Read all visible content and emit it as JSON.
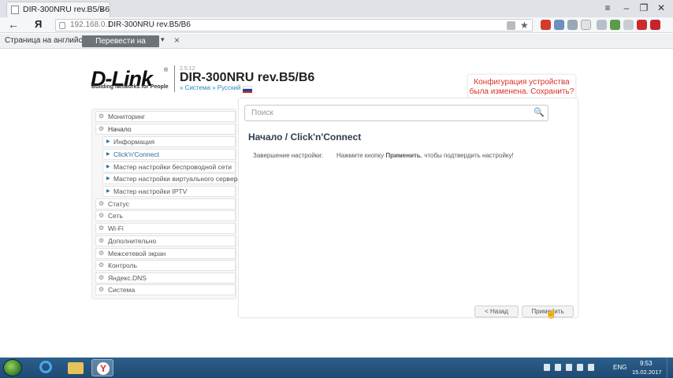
{
  "browser": {
    "tab_title": "DIR-300NRU rev.B5/B6",
    "address_ip": "192.168.0.1",
    "address_title": "DIR-300NRU rev.B5/B6",
    "yandex_logo": "Я",
    "back_icon": "←",
    "tab_close": "×",
    "star_icon": "★",
    "window_buttons": [
      "≡",
      "–",
      "❐",
      "✕"
    ]
  },
  "translate_bar": {
    "text": "Страница на английском",
    "button_label": "Перевести на русский",
    "dropdown_icon": "▾",
    "close_icon": "×"
  },
  "header": {
    "logo": "D-Link",
    "logo_reg": "®",
    "tagline": "Building Networks for People",
    "firmware_version": "2.5.12",
    "model": "DIR-300NRU rev.B5/B6",
    "breadcrumb": "» Система » Русский"
  },
  "notification": {
    "line1": "Конфигурация устройства",
    "line2": "была изменена. Сохранить?",
    "badge": "1"
  },
  "search": {
    "placeholder": "Поиск",
    "icon": "🔍"
  },
  "sidebar": {
    "items": [
      {
        "label": "Мониторинг"
      },
      {
        "label": "Начало"
      },
      {
        "label": "Информация"
      },
      {
        "label": "Click'n'Connect"
      },
      {
        "label": "Мастер настройки беспроводной сети"
      },
      {
        "label": "Мастер настройки виртуального сервера"
      },
      {
        "label": "Мастер настройки IPTV"
      },
      {
        "label": "Статус"
      },
      {
        "label": "Сеть"
      },
      {
        "label": "Wi-Fi"
      },
      {
        "label": "Дополнительно"
      },
      {
        "label": "Межсетевой экран"
      },
      {
        "label": "Контроль"
      },
      {
        "label": "Яндекс.DNS"
      },
      {
        "label": "Система"
      }
    ]
  },
  "content": {
    "title": "Начало /  Click'n'Connect",
    "setting_label": "Завершение настройки:",
    "setting_value_pre": "Нажмите кнопку ",
    "setting_value_bold": "Применить",
    "setting_value_post": ", чтобы подтвердить настройку!",
    "back_button": "< Назад",
    "apply_button": "Применить"
  },
  "taskbar": {
    "lang": "ENG",
    "time": "9:53",
    "date": "15.02.2017"
  },
  "colors": {
    "accent_red": "#d9302b",
    "link_blue": "#2a8bbd",
    "taskbar": "#1f4a72"
  }
}
